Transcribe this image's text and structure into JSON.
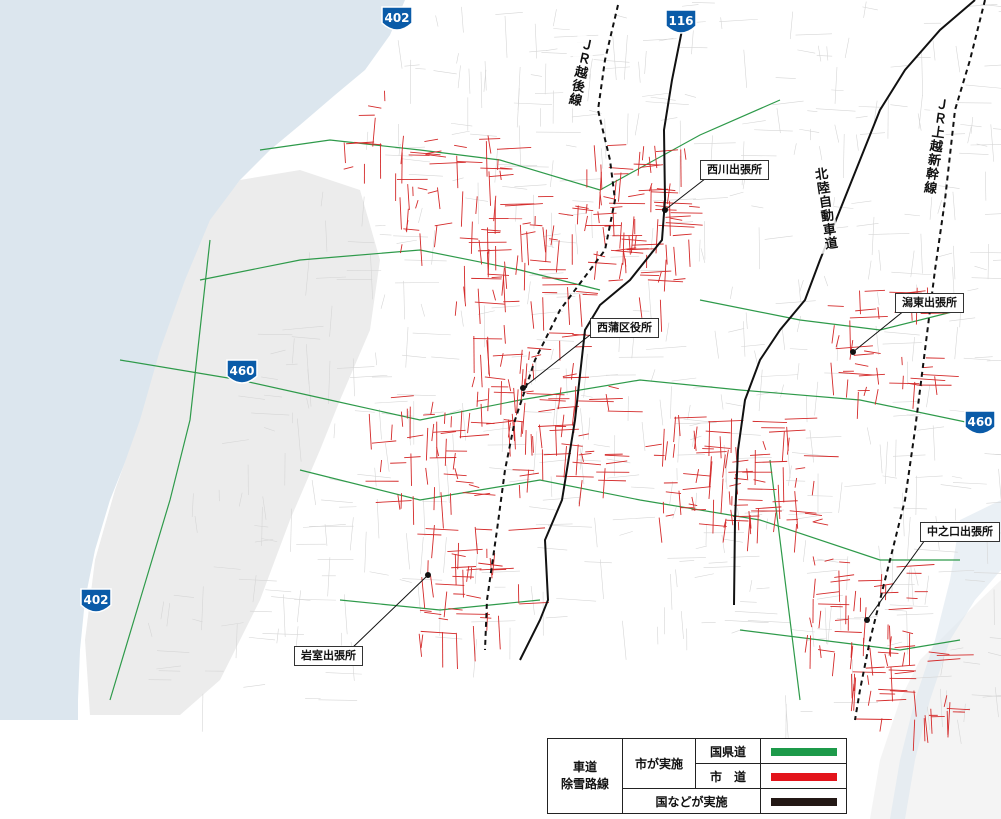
{
  "colors": {
    "sea": "#dce6ee",
    "land": "#ffffff",
    "hills": "#e4e4e4",
    "road_grid": "#cfcfcf",
    "prefectural_road": "#2e9a4a",
    "city_road": "#d42a2a",
    "national_road": "#111111",
    "shield": "#0a5ba8"
  },
  "route_shields": [
    {
      "number": "402"
    },
    {
      "number": "116"
    },
    {
      "number": "460"
    },
    {
      "number": "460"
    },
    {
      "number": "402"
    }
  ],
  "rail_labels": {
    "jr_echigo": "ＪＲ越後線",
    "jr_joetsu_shinkansen": "ＪＲ上越新幹線"
  },
  "expressway_label": "北陸自動車道",
  "offices": {
    "nishikawa": "西川出張所",
    "nishikan_ward": "西蒲区役所",
    "katahigashi": "潟東出張所",
    "nakanokuchi": "中之口出張所",
    "iwamuro": "岩室出張所"
  },
  "legend": {
    "row_header": "車道\n除雪路線",
    "city_label": "市が実施",
    "prefectural_label": "国県道",
    "city_road_label": "市　道",
    "national_label": "国などが実施",
    "prefectural_color": "#1d9a4a",
    "city_color": "#e3141b",
    "national_color": "#231815"
  }
}
